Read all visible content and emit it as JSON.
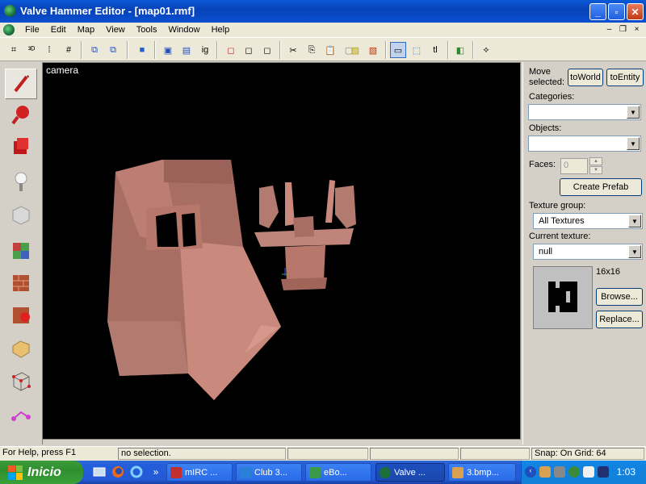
{
  "window": {
    "title": "Valve Hammer Editor - [map01.rmf]",
    "controls": {
      "minimize": "_",
      "maximize": "▫",
      "close": "✕"
    }
  },
  "menu": {
    "items": [
      "File",
      "Edit",
      "Map",
      "View",
      "Tools",
      "Window",
      "Help"
    ],
    "mdi_controls": {
      "minimize": "–",
      "restore": "❐",
      "close": "×"
    }
  },
  "toolbar": {
    "buttons": [
      {
        "icon": "grid-icon",
        "glyph": "⌗"
      },
      {
        "icon": "3d-grid-icon",
        "glyph": "³ᴰ"
      },
      {
        "icon": "dot-grid-icon",
        "glyph": "⁞"
      },
      {
        "icon": "grid-plus-icon",
        "glyph": "#"
      },
      {
        "icon": "group-icon",
        "glyph": "⧉"
      },
      {
        "icon": "ungroup-icon",
        "glyph": "⧉"
      },
      {
        "icon": "blue-cube-icon",
        "glyph": "■"
      },
      {
        "icon": "hide-icon",
        "glyph": "▣"
      },
      {
        "icon": "unhide-icon",
        "glyph": "▤"
      },
      {
        "icon": "ig-icon",
        "glyph": "ig"
      },
      {
        "icon": "red-cube-icon",
        "glyph": "◻"
      },
      {
        "icon": "wire-cube-icon",
        "glyph": "◻"
      },
      {
        "icon": "wire-cube2-icon",
        "glyph": "◻"
      },
      {
        "icon": "cut-icon",
        "glyph": "✂"
      },
      {
        "icon": "copy-icon",
        "glyph": "⎘"
      },
      {
        "icon": "paste-icon",
        "glyph": "📋"
      },
      {
        "icon": "paste-special-icon",
        "glyph": "▢"
      },
      {
        "icon": "texture-lock-icon",
        "glyph": "▨"
      },
      {
        "icon": "texture-unlock-icon",
        "glyph": "▧"
      },
      {
        "icon": "select-box-icon",
        "glyph": "▭"
      },
      {
        "icon": "select-dashed-icon",
        "glyph": "⬚"
      },
      {
        "icon": "tl-icon",
        "glyph": "tl"
      },
      {
        "icon": "carve-icon",
        "glyph": "◧"
      },
      {
        "icon": "sheep-icon",
        "glyph": "⟡"
      }
    ]
  },
  "tools": [
    {
      "name": "selection-tool",
      "active": true
    },
    {
      "name": "magnify-tool"
    },
    {
      "name": "camera-tool"
    },
    {
      "name": "entity-tool"
    },
    {
      "name": "block-tool"
    },
    {
      "name": "texture-tool"
    },
    {
      "name": "apply-texture-tool"
    },
    {
      "name": "decal-tool"
    },
    {
      "name": "clip-tool"
    },
    {
      "name": "vertex-tool"
    },
    {
      "name": "path-tool"
    }
  ],
  "viewport": {
    "label": "camera"
  },
  "right_panel": {
    "move_selected_label": "Move selected:",
    "to_world": "toWorld",
    "to_entity": "toEntity",
    "categories_label": "Categories:",
    "categories_value": "",
    "objects_label": "Objects:",
    "objects_value": "",
    "faces_label": "Faces:",
    "faces_value": "0",
    "create_prefab": "Create Prefab",
    "texture_group_label": "Texture group:",
    "texture_group_value": "All Textures",
    "current_texture_label": "Current texture:",
    "current_texture_value": "null",
    "texture_size": "16x16",
    "browse": "Browse...",
    "replace": "Replace..."
  },
  "status": {
    "help": "For Help, press F1",
    "selection": "no selection.",
    "snap": "Snap: On Grid: 64"
  },
  "taskbar": {
    "start_label": "Inicio",
    "quicklaunch_more": "»",
    "tasks": [
      {
        "label": "mIRC ...",
        "color": "#c03030"
      },
      {
        "label": "Club 3...",
        "color": "#2a7fd8"
      },
      {
        "label": "eBo...",
        "color": "#3a9a4a"
      },
      {
        "label": "Valve ...",
        "color": "#1b6f3a",
        "active": true
      },
      {
        "label": "3.bmp...",
        "color": "#d8a050"
      }
    ],
    "clock": "1:03"
  }
}
